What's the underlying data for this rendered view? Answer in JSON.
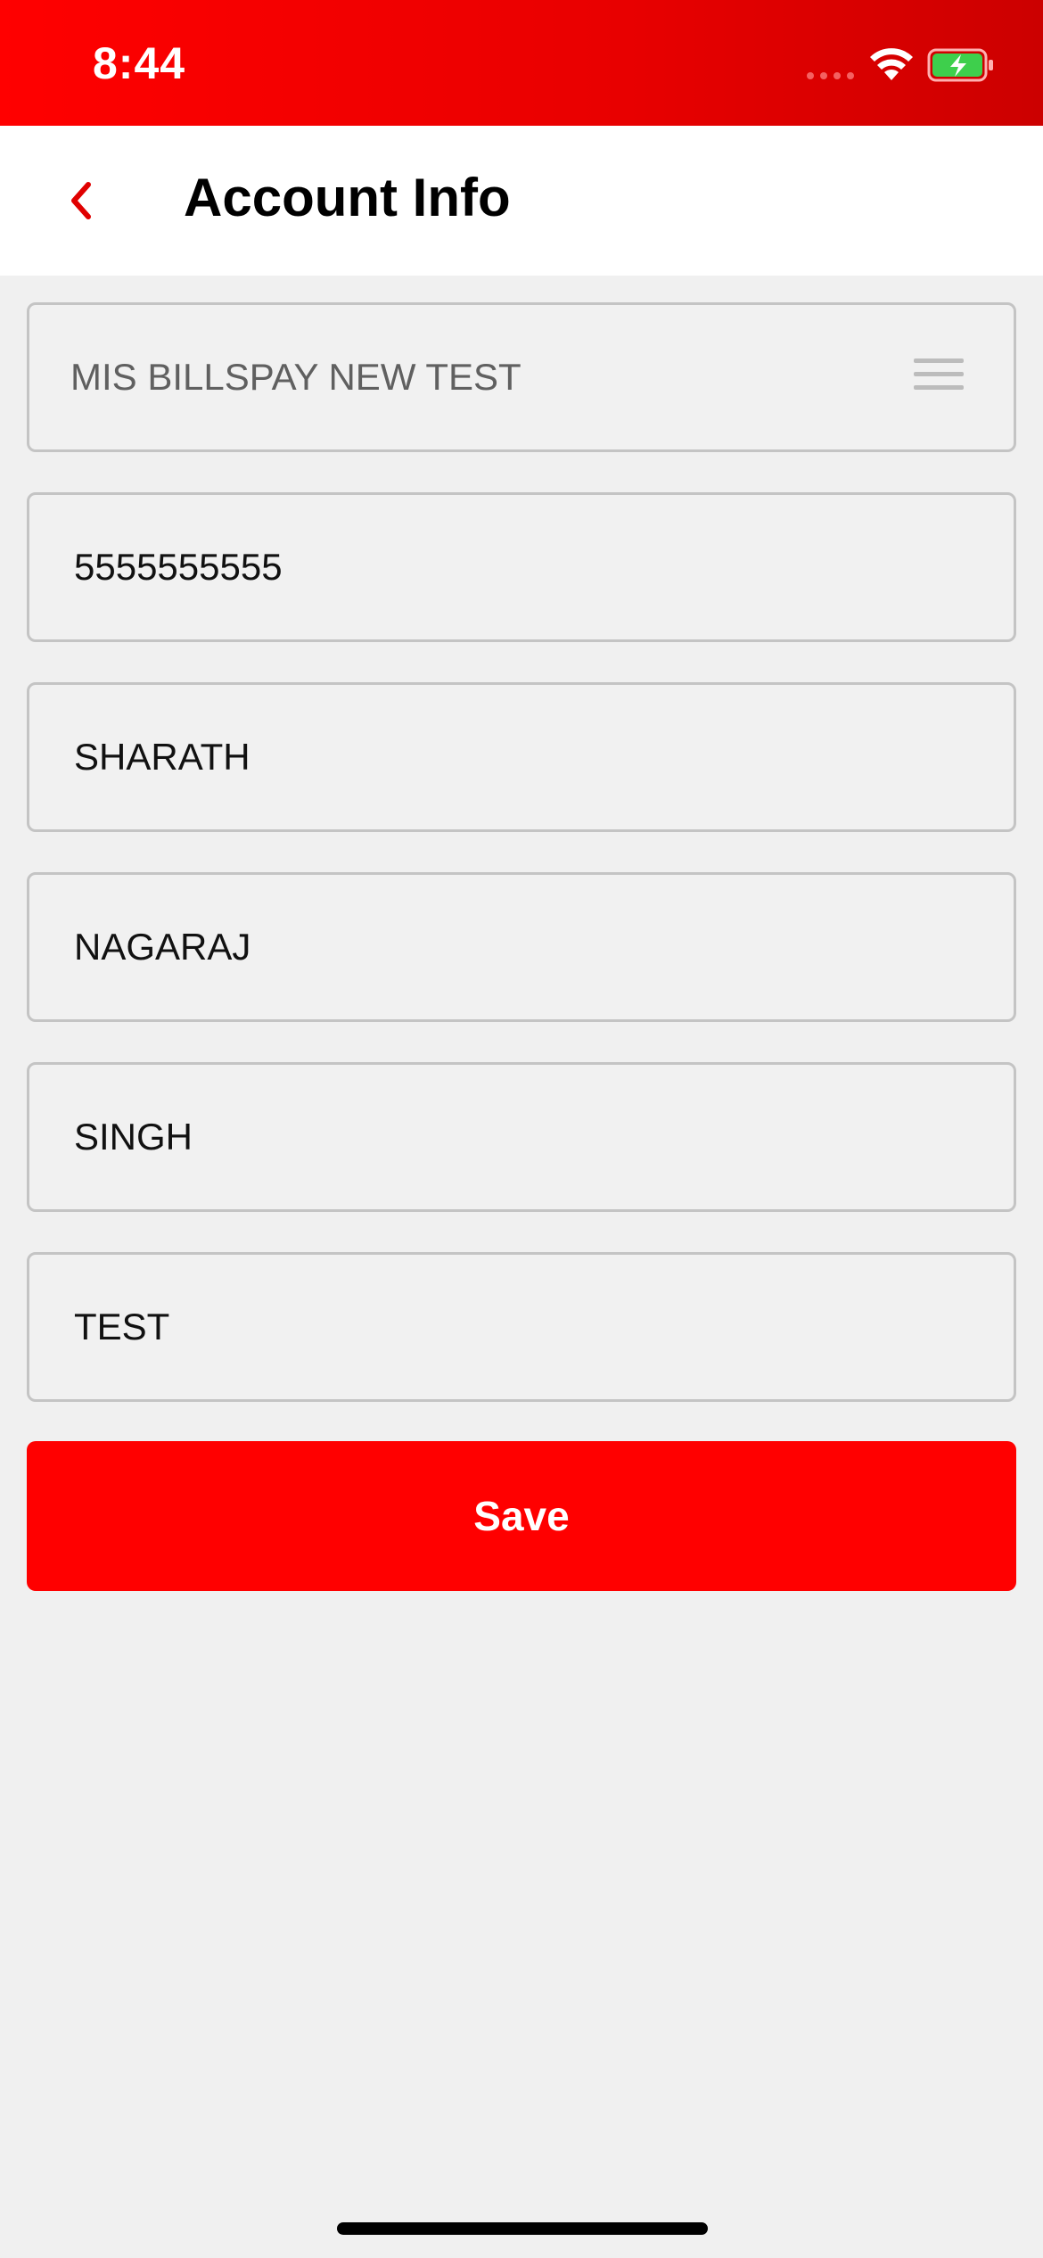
{
  "status_bar": {
    "time": "8:44",
    "signal_icon": "signal-dots-icon",
    "wifi_icon": "wifi-icon",
    "battery_icon": "battery-charging-icon",
    "battery_color": "#3ecf4c"
  },
  "nav": {
    "back_icon": "chevron-left-icon",
    "title": "Account Info"
  },
  "form": {
    "account_select": {
      "value": "MIS BILLSPAY NEW TEST",
      "icon": "menu-icon"
    },
    "fields": [
      {
        "value": "5555555555"
      },
      {
        "value": "SHARATH"
      },
      {
        "value": "NAGARAJ"
      },
      {
        "value": "SINGH"
      },
      {
        "value": "TEST"
      }
    ],
    "save_label": "Save"
  },
  "colors": {
    "accent": "#ff0000",
    "background": "#f0f0f0",
    "field_border": "#c4c4c4"
  }
}
